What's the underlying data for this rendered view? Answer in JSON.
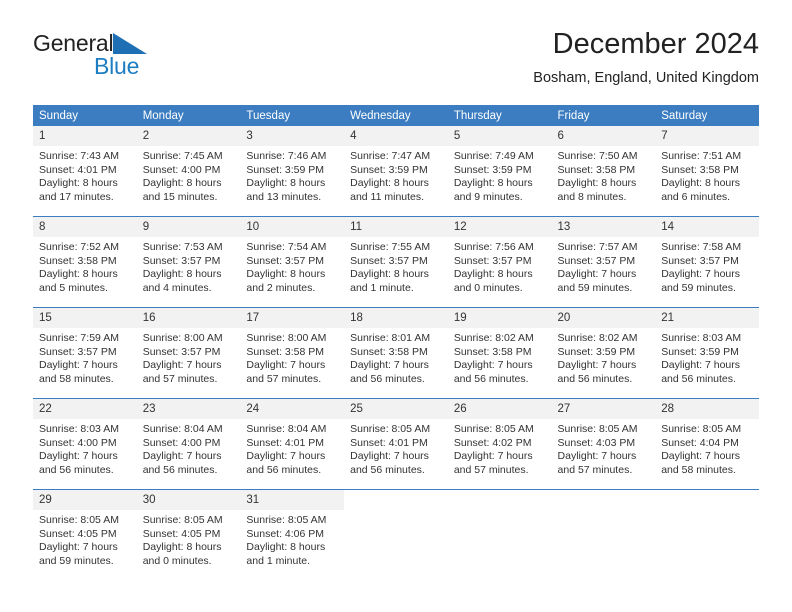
{
  "brand": {
    "name_line1": "General",
    "name_line2": "Blue",
    "accent_color": "#1d7dc2",
    "triangle_color": "#1f6fb5"
  },
  "header": {
    "title": "December 2024",
    "location": "Bosham, England, United Kingdom"
  },
  "calendar": {
    "header_bg": "#3b7dc0",
    "daynum_bg": "#f2f2f2",
    "weekday_headers": [
      "Sunday",
      "Monday",
      "Tuesday",
      "Wednesday",
      "Thursday",
      "Friday",
      "Saturday"
    ],
    "weeks": [
      [
        {
          "day": "1",
          "sunrise": "Sunrise: 7:43 AM",
          "sunset": "Sunset: 4:01 PM",
          "daylight_line1": "Daylight: 8 hours",
          "daylight_line2": "and 17 minutes."
        },
        {
          "day": "2",
          "sunrise": "Sunrise: 7:45 AM",
          "sunset": "Sunset: 4:00 PM",
          "daylight_line1": "Daylight: 8 hours",
          "daylight_line2": "and 15 minutes."
        },
        {
          "day": "3",
          "sunrise": "Sunrise: 7:46 AM",
          "sunset": "Sunset: 3:59 PM",
          "daylight_line1": "Daylight: 8 hours",
          "daylight_line2": "and 13 minutes."
        },
        {
          "day": "4",
          "sunrise": "Sunrise: 7:47 AM",
          "sunset": "Sunset: 3:59 PM",
          "daylight_line1": "Daylight: 8 hours",
          "daylight_line2": "and 11 minutes."
        },
        {
          "day": "5",
          "sunrise": "Sunrise: 7:49 AM",
          "sunset": "Sunset: 3:59 PM",
          "daylight_line1": "Daylight: 8 hours",
          "daylight_line2": "and 9 minutes."
        },
        {
          "day": "6",
          "sunrise": "Sunrise: 7:50 AM",
          "sunset": "Sunset: 3:58 PM",
          "daylight_line1": "Daylight: 8 hours",
          "daylight_line2": "and 8 minutes."
        },
        {
          "day": "7",
          "sunrise": "Sunrise: 7:51 AM",
          "sunset": "Sunset: 3:58 PM",
          "daylight_line1": "Daylight: 8 hours",
          "daylight_line2": "and 6 minutes."
        }
      ],
      [
        {
          "day": "8",
          "sunrise": "Sunrise: 7:52 AM",
          "sunset": "Sunset: 3:58 PM",
          "daylight_line1": "Daylight: 8 hours",
          "daylight_line2": "and 5 minutes."
        },
        {
          "day": "9",
          "sunrise": "Sunrise: 7:53 AM",
          "sunset": "Sunset: 3:57 PM",
          "daylight_line1": "Daylight: 8 hours",
          "daylight_line2": "and 4 minutes."
        },
        {
          "day": "10",
          "sunrise": "Sunrise: 7:54 AM",
          "sunset": "Sunset: 3:57 PM",
          "daylight_line1": "Daylight: 8 hours",
          "daylight_line2": "and 2 minutes."
        },
        {
          "day": "11",
          "sunrise": "Sunrise: 7:55 AM",
          "sunset": "Sunset: 3:57 PM",
          "daylight_line1": "Daylight: 8 hours",
          "daylight_line2": "and 1 minute."
        },
        {
          "day": "12",
          "sunrise": "Sunrise: 7:56 AM",
          "sunset": "Sunset: 3:57 PM",
          "daylight_line1": "Daylight: 8 hours",
          "daylight_line2": "and 0 minutes."
        },
        {
          "day": "13",
          "sunrise": "Sunrise: 7:57 AM",
          "sunset": "Sunset: 3:57 PM",
          "daylight_line1": "Daylight: 7 hours",
          "daylight_line2": "and 59 minutes."
        },
        {
          "day": "14",
          "sunrise": "Sunrise: 7:58 AM",
          "sunset": "Sunset: 3:57 PM",
          "daylight_line1": "Daylight: 7 hours",
          "daylight_line2": "and 59 minutes."
        }
      ],
      [
        {
          "day": "15",
          "sunrise": "Sunrise: 7:59 AM",
          "sunset": "Sunset: 3:57 PM",
          "daylight_line1": "Daylight: 7 hours",
          "daylight_line2": "and 58 minutes."
        },
        {
          "day": "16",
          "sunrise": "Sunrise: 8:00 AM",
          "sunset": "Sunset: 3:57 PM",
          "daylight_line1": "Daylight: 7 hours",
          "daylight_line2": "and 57 minutes."
        },
        {
          "day": "17",
          "sunrise": "Sunrise: 8:00 AM",
          "sunset": "Sunset: 3:58 PM",
          "daylight_line1": "Daylight: 7 hours",
          "daylight_line2": "and 57 minutes."
        },
        {
          "day": "18",
          "sunrise": "Sunrise: 8:01 AM",
          "sunset": "Sunset: 3:58 PM",
          "daylight_line1": "Daylight: 7 hours",
          "daylight_line2": "and 56 minutes."
        },
        {
          "day": "19",
          "sunrise": "Sunrise: 8:02 AM",
          "sunset": "Sunset: 3:58 PM",
          "daylight_line1": "Daylight: 7 hours",
          "daylight_line2": "and 56 minutes."
        },
        {
          "day": "20",
          "sunrise": "Sunrise: 8:02 AM",
          "sunset": "Sunset: 3:59 PM",
          "daylight_line1": "Daylight: 7 hours",
          "daylight_line2": "and 56 minutes."
        },
        {
          "day": "21",
          "sunrise": "Sunrise: 8:03 AM",
          "sunset": "Sunset: 3:59 PM",
          "daylight_line1": "Daylight: 7 hours",
          "daylight_line2": "and 56 minutes."
        }
      ],
      [
        {
          "day": "22",
          "sunrise": "Sunrise: 8:03 AM",
          "sunset": "Sunset: 4:00 PM",
          "daylight_line1": "Daylight: 7 hours",
          "daylight_line2": "and 56 minutes."
        },
        {
          "day": "23",
          "sunrise": "Sunrise: 8:04 AM",
          "sunset": "Sunset: 4:00 PM",
          "daylight_line1": "Daylight: 7 hours",
          "daylight_line2": "and 56 minutes."
        },
        {
          "day": "24",
          "sunrise": "Sunrise: 8:04 AM",
          "sunset": "Sunset: 4:01 PM",
          "daylight_line1": "Daylight: 7 hours",
          "daylight_line2": "and 56 minutes."
        },
        {
          "day": "25",
          "sunrise": "Sunrise: 8:05 AM",
          "sunset": "Sunset: 4:01 PM",
          "daylight_line1": "Daylight: 7 hours",
          "daylight_line2": "and 56 minutes."
        },
        {
          "day": "26",
          "sunrise": "Sunrise: 8:05 AM",
          "sunset": "Sunset: 4:02 PM",
          "daylight_line1": "Daylight: 7 hours",
          "daylight_line2": "and 57 minutes."
        },
        {
          "day": "27",
          "sunrise": "Sunrise: 8:05 AM",
          "sunset": "Sunset: 4:03 PM",
          "daylight_line1": "Daylight: 7 hours",
          "daylight_line2": "and 57 minutes."
        },
        {
          "day": "28",
          "sunrise": "Sunrise: 8:05 AM",
          "sunset": "Sunset: 4:04 PM",
          "daylight_line1": "Daylight: 7 hours",
          "daylight_line2": "and 58 minutes."
        }
      ],
      [
        {
          "day": "29",
          "sunrise": "Sunrise: 8:05 AM",
          "sunset": "Sunset: 4:05 PM",
          "daylight_line1": "Daylight: 7 hours",
          "daylight_line2": "and 59 minutes."
        },
        {
          "day": "30",
          "sunrise": "Sunrise: 8:05 AM",
          "sunset": "Sunset: 4:05 PM",
          "daylight_line1": "Daylight: 8 hours",
          "daylight_line2": "and 0 minutes."
        },
        {
          "day": "31",
          "sunrise": "Sunrise: 8:05 AM",
          "sunset": "Sunset: 4:06 PM",
          "daylight_line1": "Daylight: 8 hours",
          "daylight_line2": "and 1 minute."
        },
        {
          "day": "",
          "sunrise": "",
          "sunset": "",
          "daylight_line1": "",
          "daylight_line2": ""
        },
        {
          "day": "",
          "sunrise": "",
          "sunset": "",
          "daylight_line1": "",
          "daylight_line2": ""
        },
        {
          "day": "",
          "sunrise": "",
          "sunset": "",
          "daylight_line1": "",
          "daylight_line2": ""
        },
        {
          "day": "",
          "sunrise": "",
          "sunset": "",
          "daylight_line1": "",
          "daylight_line2": ""
        }
      ]
    ]
  }
}
